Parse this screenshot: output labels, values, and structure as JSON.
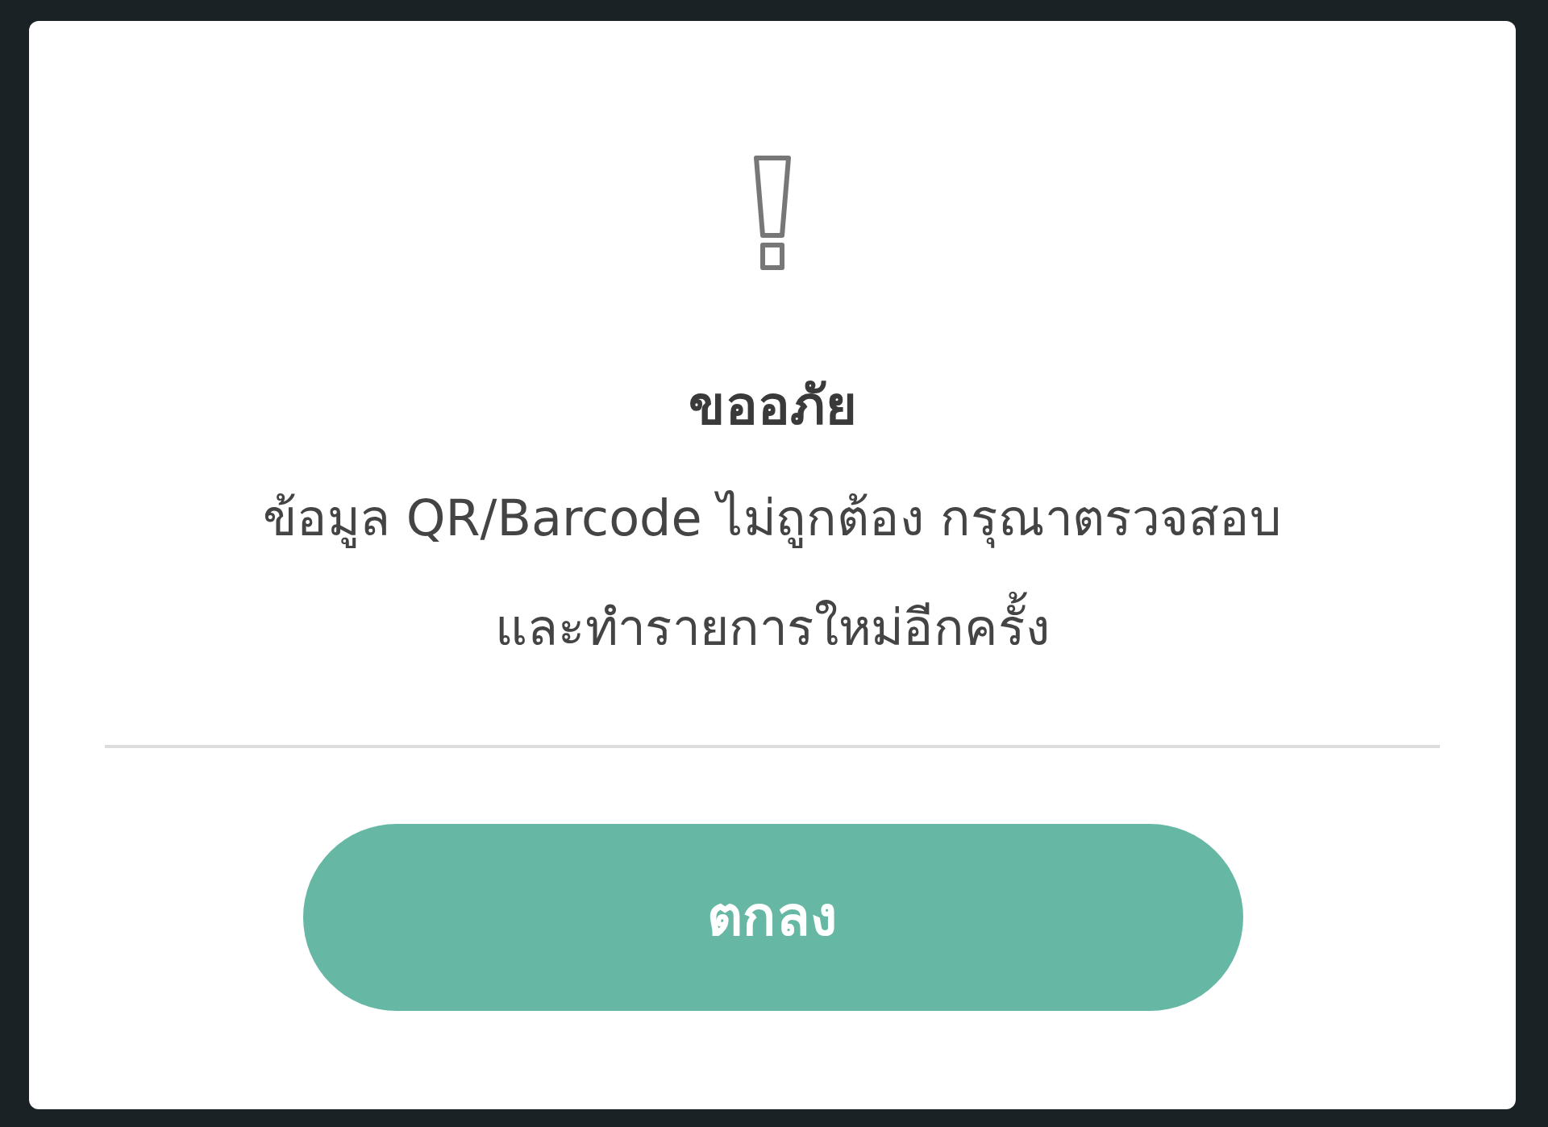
{
  "dialog": {
    "title": "ขออภัย",
    "message_lines": [
      "ข้อมูล QR/Barcode ไม่ถูกต้อง กรุณาตรวจสอบ",
      "และทำรายการใหม่อีกครั้ง"
    ],
    "button": "ตกลง"
  }
}
